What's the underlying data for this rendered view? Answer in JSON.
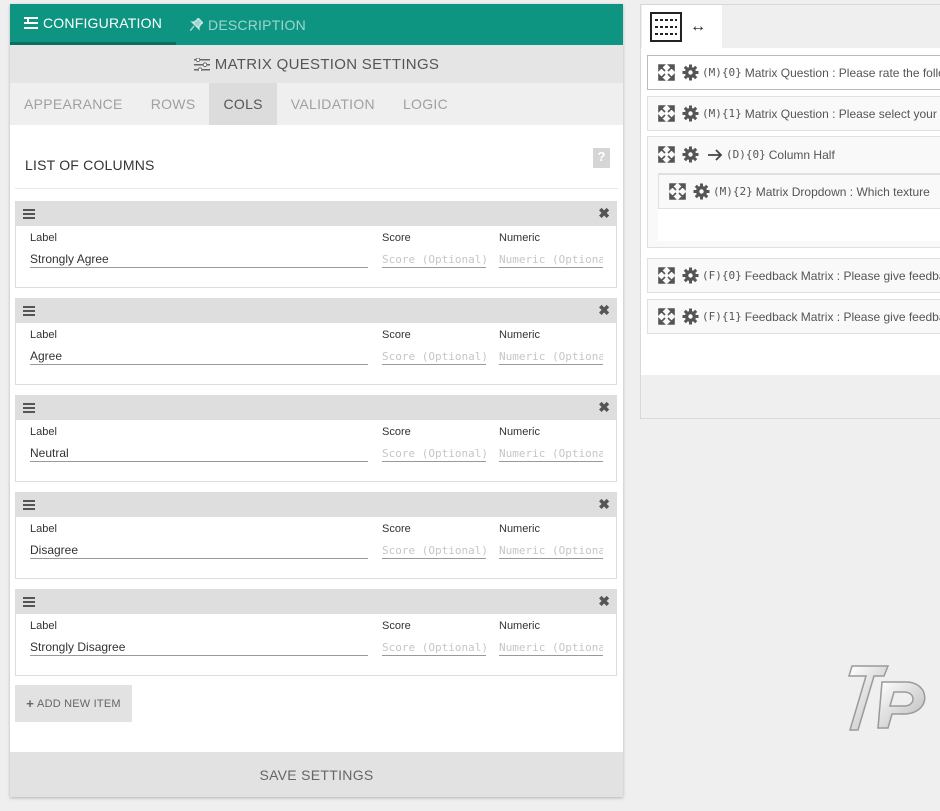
{
  "top_tabs": [
    {
      "label": "CONFIGURATION",
      "icon": "list-icon",
      "active": true
    },
    {
      "label": "DESCRIPTION",
      "icon": "pin-icon",
      "active": false
    }
  ],
  "settings_title": "MATRIX QUESTION SETTINGS",
  "sub_tabs": [
    "APPEARANCE",
    "ROWS",
    "COLS",
    "VALIDATION",
    "LOGIC"
  ],
  "active_sub_tab": "COLS",
  "list_title": "LIST OF COLUMNS",
  "column_field_labels": {
    "label": "Label",
    "score": "Score",
    "numeric": "Numeric"
  },
  "placeholders": {
    "score": "Score (Optional)",
    "numeric": "Numeric (Optional)"
  },
  "columns": [
    {
      "label": "Strongly Agree"
    },
    {
      "label": "Agree"
    },
    {
      "label": "Neutral"
    },
    {
      "label": "Disagree"
    },
    {
      "label": "Strongly Disagree"
    }
  ],
  "add_button": "ADD NEW ITEM",
  "save_button": "SAVE SETTINGS",
  "right_panel": {
    "toolbar_arrows": "↔",
    "items": [
      {
        "code": "(M){0}",
        "text": "Matrix Question : Please rate the following"
      },
      {
        "code": "(M){1}",
        "text": "Matrix Question : Please select your"
      },
      {
        "code": "(D){0}",
        "text": "Column Half"
      },
      {
        "code": "(M){2}",
        "text": "Matrix Dropdown : Which texture"
      },
      {
        "code": "(F){0}",
        "text": "Feedback Matrix : Please give feedback"
      },
      {
        "code": "(F){1}",
        "text": "Feedback Matrix : Please give feedback"
      }
    ]
  },
  "colors": {
    "accent": "#0d9582",
    "panel_bg": "#efefef",
    "header_bg": "#e5e5e5"
  }
}
